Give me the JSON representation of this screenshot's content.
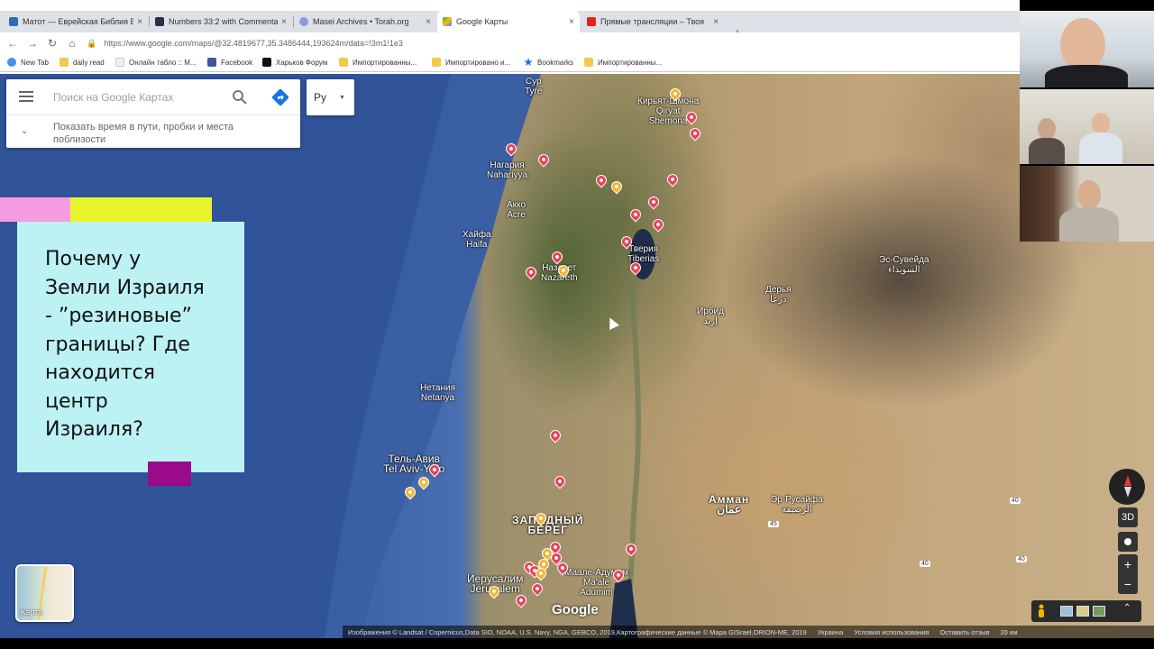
{
  "tabs": [
    {
      "title": "Матот — Еврейская Библия Бе",
      "favicon_color": "#2a6db5"
    },
    {
      "title": "Numbers 33:2 with Commentary",
      "favicon_color": "#2b3050"
    },
    {
      "title": "Masei Archives • Torah.org",
      "favicon_color": "#8a9bd8"
    },
    {
      "title": "Google Карты",
      "favicon_color": "#34a853",
      "active": true
    },
    {
      "title": "Прямые трансляции – Твоя",
      "favicon_color": "#e62117"
    }
  ],
  "tab_close": "×",
  "new_tab": "+",
  "url": "https://www.google.com/maps/@32.4819677,35.3486444,193624m/data=!3m1!1e3",
  "bookmarks": [
    {
      "label": "New Tab",
      "color": "#4a8fe7"
    },
    {
      "label": "daily read",
      "color": "#f2c94c"
    },
    {
      "label": "Онлайн табло :: М...",
      "color": "#eeeeee"
    },
    {
      "label": "Facebook",
      "color": "#3b5998"
    },
    {
      "label": "Харьков Форум",
      "color": "#111111"
    },
    {
      "label": "Импортированны...",
      "color": "#f2c94c"
    },
    {
      "label": "Импортировано и...",
      "color": "#f2c94c"
    },
    {
      "label": "Bookmarks",
      "color": "#1a73e8"
    },
    {
      "label": "Импортированны...",
      "color": "#f2c94c"
    }
  ],
  "search": {
    "placeholder": "Поиск на Google Картах",
    "traffic_hint": "Показать время в пути, пробки и места поблизости"
  },
  "language": "Ру",
  "slide": {
    "text": "Почему у\nЗемли Израиля\n- ”резиновые”\nграницы? Где\nнаходится\nцентр\nИзраиля?"
  },
  "places": [
    {
      "label": "Сур\nTyre"
    },
    {
      "label": "Кирьят-Шмона\nQiryat\nShemona"
    },
    {
      "label": "Нагария\nNahariyya"
    },
    {
      "label": "Акко\nAcre"
    },
    {
      "label": "Хайфа\nHaifa"
    },
    {
      "label": "Тверия\nTiberias"
    },
    {
      "label": "Назарет\nNazareth"
    },
    {
      "label": "Эс-Сувейда\nالسويداء"
    },
    {
      "label": "Дерья\nدرعا"
    },
    {
      "label": "Ирбид\nإربد"
    },
    {
      "label": "Нетания\nNetanya"
    },
    {
      "label": "Тель-Авив\nTel Aviv-Yafo"
    },
    {
      "label": "ЗАПАДНЫЙ\nБЕРЕГ"
    },
    {
      "label": "Амман\nعمان"
    },
    {
      "label": "Эр-Русайфа\nالرصيفة"
    },
    {
      "label": "Иерусалим\nJerusalem"
    },
    {
      "label": "Маале-Адумим\nMa'ale\nAdumim"
    }
  ],
  "road_badges": [
    "45",
    "40",
    "40",
    "40"
  ],
  "layer_toggle": "Карта",
  "controls": {
    "three_d": "3D",
    "zoom_in": "+",
    "zoom_out": "−",
    "pegman_up": "⌃"
  },
  "google_logo": "Google",
  "attribution": {
    "imagery": "Изображения © Landsat / Copernicus,Data SIO, NOAA, U.S. Navy, NGA, GEBCO, 2019,Картографические данные © Mapa GISrael,ORION-ME, 2019",
    "country": "Украина",
    "terms": "Условия использования",
    "feedback": "Оставить отзыв",
    "scale": "20 км"
  }
}
